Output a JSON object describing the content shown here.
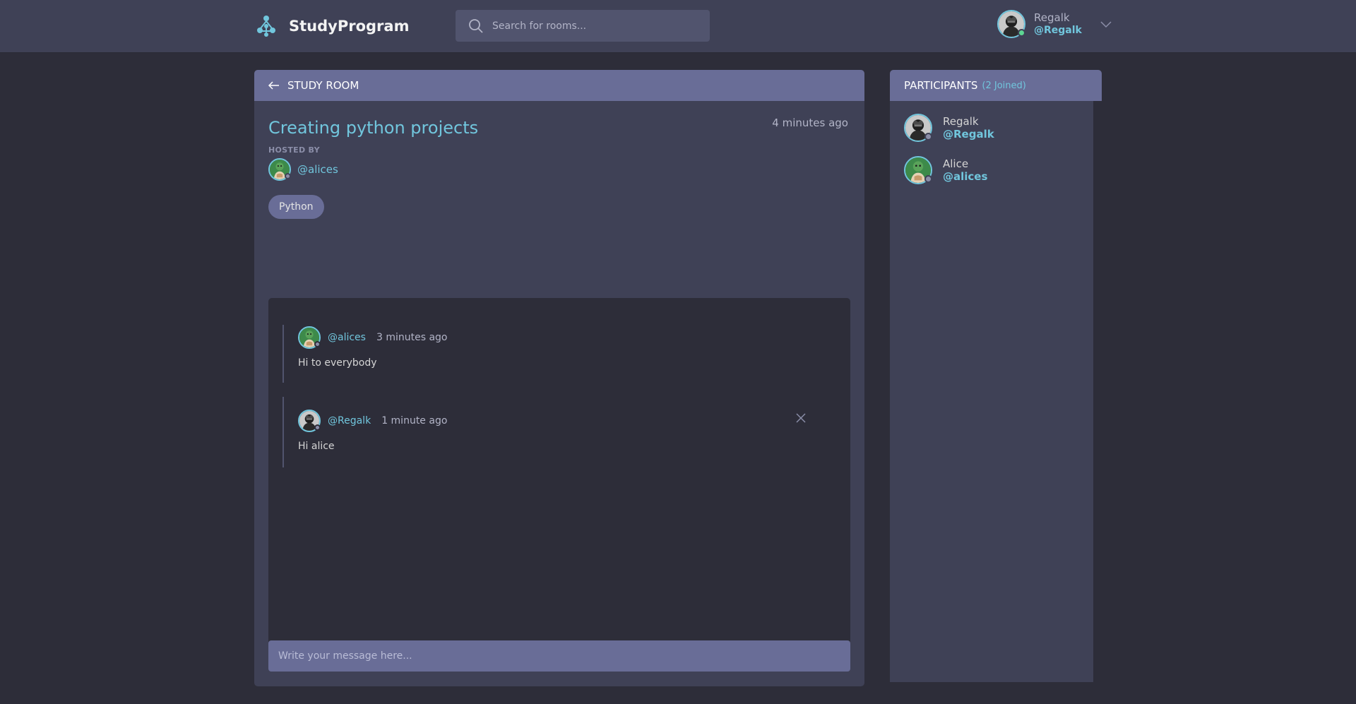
{
  "header": {
    "app_name": "StudyProgram",
    "search_placeholder": "Search for rooms...",
    "user": {
      "name": "Regalk",
      "handle": "@Regalk",
      "status": "online"
    }
  },
  "room": {
    "section_label": "STUDY ROOM",
    "title": "Creating python projects",
    "created_ago": "4 minutes ago",
    "hosted_by_label": "HOSTED BY",
    "host_handle": "@alices",
    "topic": "Python",
    "messages": [
      {
        "handle": "@alices",
        "time": "3 minutes ago",
        "body": "Hi to everybody",
        "deletable": false
      },
      {
        "handle": "@Regalk",
        "time": "1 minute ago",
        "body": "Hi alice",
        "deletable": true
      }
    ],
    "composer_placeholder": "Write your message here..."
  },
  "participants": {
    "title": "PARTICIPANTS",
    "count_label": "(2 Joined)",
    "list": [
      {
        "name": "Regalk",
        "handle": "@Regalk"
      },
      {
        "name": "Alice",
        "handle": "@alices"
      }
    ]
  },
  "colors": {
    "accent": "#71c6dd",
    "panel": "#3f4156",
    "panel_header": "#696d97",
    "background": "#2d2d39",
    "online": "#5dd693",
    "offline": "#8b8ea8"
  }
}
